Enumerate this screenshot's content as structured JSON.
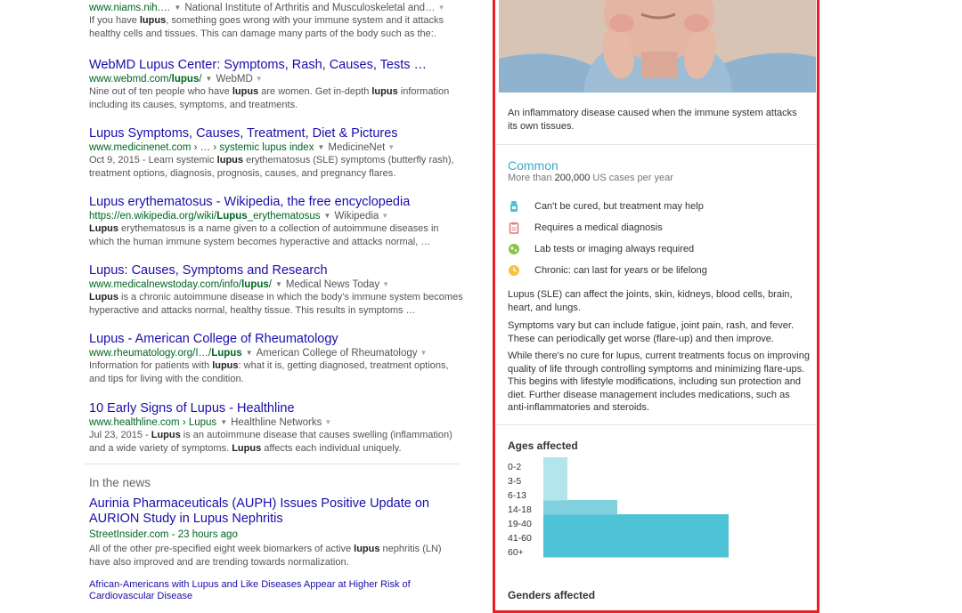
{
  "results": [
    {
      "title": "",
      "url": "www.niams.nih.…",
      "source": "National Institute of Arthritis and Musculoskeletal and…",
      "snippet_html": "If you have <b>lupus</b>, something goes wrong with your immune system and it attacks healthy cells and tissues. This can damage many parts of the body such as the:."
    },
    {
      "title": "WebMD Lupus Center: Symptoms, Rash, Causes, Tests …",
      "url_html": "www.webmd.com/<b>lupus</b>/",
      "source": "WebMD",
      "snippet_html": "Nine out of ten people who have <b>lupus</b> are women. Get in-depth <b>lupus</b> information including its causes, symptoms, and treatments."
    },
    {
      "title": "Lupus Symptoms, Causes, Treatment, Diet & Pictures",
      "url_html": "www.medicinenet.com › … › systemic lupus index",
      "source": "MedicineNet",
      "snippet_html": "Oct 9, 2015 - Learn systemic <b>lupus</b> erythematosus (SLE) symptoms (butterfly rash), treatment options, diagnosis, prognosis, causes, and pregnancy flares."
    },
    {
      "title": "Lupus erythematosus - Wikipedia, the free encyclopedia",
      "url_html": "https://en.wikipedia.org/wiki/<b>Lupus</b>_erythematosus",
      "source": "Wikipedia",
      "snippet_html": "<b>Lupus</b> erythematosus is a name given to a collection of autoimmune diseases in which the human immune system becomes hyperactive and attacks normal, …"
    },
    {
      "title": "Lupus: Causes, Symptoms and Research",
      "url_html": "www.medicalnewstoday.com/info/<b>lupus</b>/",
      "source": "Medical News Today",
      "snippet_html": "<b>Lupus</b> is a chronic autoimmune disease in which the body's immune system becomes hyperactive and attacks normal, healthy tissue. This results in symptoms …"
    },
    {
      "title": "Lupus - American College of Rheumatology",
      "url_html": "www.rheumatology.org/I…/<b>Lupus</b>",
      "source": "American College of Rheumatology",
      "snippet_html": "Information for patients with <b>lupus</b>: what it is, getting diagnosed, treatment options, and tips for living with the condition."
    },
    {
      "title": "10 Early Signs of Lupus - Healthline",
      "url_html": "www.healthline.com › Lupus",
      "source": "Healthline Networks",
      "snippet_html": "Jul 23, 2015 - <b>Lupus</b> is an autoimmune disease that causes swelling (inflammation) and a wide variety of symptoms. <b>Lupus</b> affects each individual uniquely."
    }
  ],
  "news": {
    "heading": "In the news",
    "top": {
      "title": "Aurinia Pharmaceuticals (AUPH) Issues Positive Update on AURION Study in Lupus Nephritis",
      "meta": "StreetInsider.com - 23 hours ago",
      "snippet_html": "All of the other pre-specified eight week biomarkers of active <b>lupus</b> nephritis (LN) have also improved and are trending towards normalization."
    },
    "sub_link": "African-Americans with Lupus and Like Diseases Appear at Higher Risk of Cardiovascular Disease"
  },
  "panel": {
    "description": "An inflammatory disease caused when the immune system attacks its own tissues.",
    "prevalence_title": "Common",
    "prevalence_pre": "More than ",
    "prevalence_count": "200,000",
    "prevalence_post": " US cases per year",
    "facts": [
      {
        "icon": "medicine-bottle-icon",
        "color": "#4fc3d6",
        "text": "Can't be cured, but treatment may help"
      },
      {
        "icon": "clipboard-icon",
        "color": "#e57373",
        "text": "Requires a medical diagnosis"
      },
      {
        "icon": "lab-test-icon",
        "color": "#8bc34a",
        "text": "Lab tests or imaging always required"
      },
      {
        "icon": "clock-icon",
        "color": "#f9c23c",
        "text": "Chronic: can last for years or be lifelong"
      }
    ],
    "paragraphs": [
      "Lupus (SLE) can affect the joints, skin, kidneys, blood cells, brain, heart, and lungs.",
      "Symptoms vary but can include fatigue, joint pain, rash, and fever. These can periodically get worse (flare-up) and then improve.",
      "While there's no cure for lupus, current treatments focus on improving quality of life through controlling symptoms and minimizing flare-ups. This begins with lifestyle modifications, including sun protection and diet. Further disease management includes medications, such as anti-inflammatories and steroids."
    ],
    "ages_title": "Ages affected",
    "genders_title": "Genders affected"
  },
  "chart_data": {
    "type": "bar",
    "orientation": "horizontal",
    "title": "Ages affected",
    "categories": [
      "0-2",
      "3-5",
      "6-13",
      "14-18",
      "19-40",
      "41-60",
      "60+"
    ],
    "values": [
      0.13,
      0.13,
      0.13,
      0.4,
      1.0,
      1.0,
      1.0
    ],
    "xlim": [
      0,
      1
    ],
    "colors": [
      "#b3e5ec",
      "#b3e5ec",
      "#b3e5ec",
      "#80d0dd",
      "#4fc3d6",
      "#4fc3d6",
      "#4fc3d6"
    ],
    "grid": false
  },
  "colors": {
    "link": "#1a0dab",
    "url": "#006621",
    "panel_border": "#e8202a",
    "accent": "#3ca9c4"
  }
}
